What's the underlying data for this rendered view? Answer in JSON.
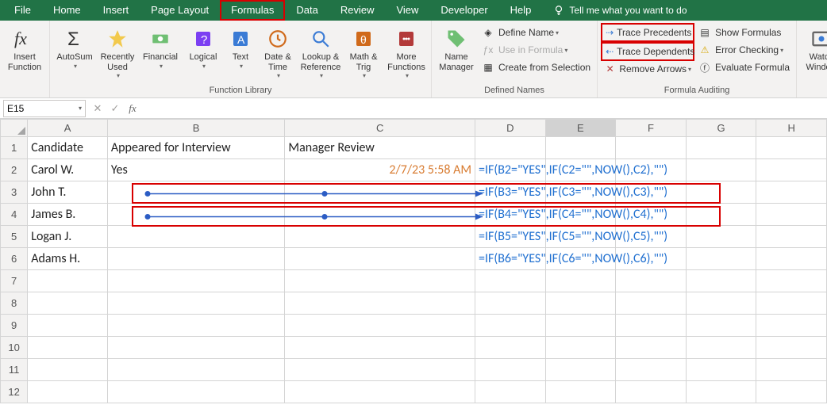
{
  "tabs": {
    "file": "File",
    "home": "Home",
    "insert": "Insert",
    "page_layout": "Page Layout",
    "formulas": "Formulas",
    "data": "Data",
    "review": "Review",
    "view": "View",
    "developer": "Developer",
    "help": "Help",
    "tell_me": "Tell me what you want to do"
  },
  "ribbon": {
    "function_library": {
      "label": "Function Library",
      "insert_function": "Insert\nFunction",
      "autosum": "AutoSum",
      "recently_used": "Recently\nUsed",
      "financial": "Financial",
      "logical": "Logical",
      "text": "Text",
      "date_time": "Date &\nTime",
      "lookup_ref": "Lookup &\nReference",
      "math_trig": "Math &\nTrig",
      "more_fn": "More\nFunctions"
    },
    "defined_names": {
      "label": "Defined Names",
      "name_manager": "Name\nManager",
      "define_name": "Define Name",
      "use_in_formula": "Use in Formula",
      "create_from_sel": "Create from Selection"
    },
    "formula_auditing": {
      "label": "Formula Auditing",
      "trace_precedents": "Trace Precedents",
      "trace_dependents": "Trace Dependents",
      "remove_arrows": "Remove Arrows",
      "show_formulas": "Show Formulas",
      "error_checking": "Error Checking",
      "evaluate_formula": "Evaluate Formula"
    },
    "watch_window": "Watch\nWindow"
  },
  "name_box": "E15",
  "columns": [
    "A",
    "B",
    "C",
    "D",
    "E",
    "F",
    "G",
    "H"
  ],
  "selected_col": "E",
  "selected_cell": "E15",
  "row_count": 12,
  "headers": {
    "A": "Candidate",
    "B": "Appeared for Interview",
    "C": "Manager Review"
  },
  "rows": [
    {
      "A": "Carol W.",
      "B": "Yes",
      "C": "2/7/23 5:58 AM",
      "D": "=IF(B2=\"YES\",IF(C2=\"\",NOW(),C2),\"\")",
      "trace": false
    },
    {
      "A": "John T.",
      "B": "",
      "C": "",
      "D": "=IF(B3=\"YES\",IF(C3=\"\",NOW(),C3),\"\")",
      "trace": true
    },
    {
      "A": "James B.",
      "B": "",
      "C": "",
      "D": "=IF(B4=\"YES\",IF(C4=\"\",NOW(),C4),\"\")",
      "trace": true
    },
    {
      "A": "Logan J.",
      "B": "",
      "C": "",
      "D": "=IF(B5=\"YES\",IF(C5=\"\",NOW(),C5),\"\")",
      "trace": false
    },
    {
      "A": "Adams H.",
      "B": "",
      "C": "",
      "D": "=IF(B6=\"YES\",IF(C6=\"\",NOW(),C6),\"\")",
      "trace": false
    }
  ]
}
